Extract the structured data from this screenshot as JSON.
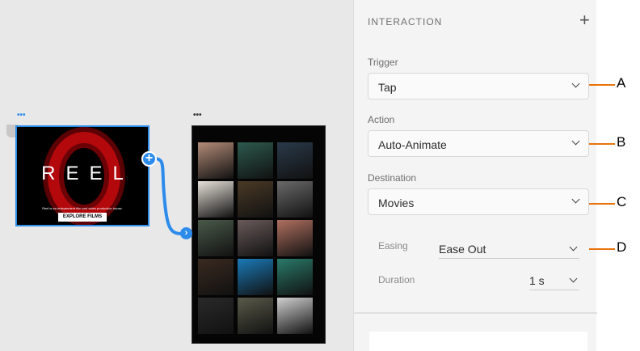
{
  "canvas": {
    "artboard1": {
      "dots": "•••",
      "title": "REEL",
      "tagline": "Reel is an independent film and video production house.",
      "button": "EXPLORE FILMS"
    },
    "artboard2": {
      "dots": "•••",
      "tile_colors": [
        "#b48c78",
        "#2d5a4e",
        "#2a3a4a",
        "#e8e2da",
        "#4a3a26",
        "#6a6a6a",
        "#4a5a4a",
        "#6a5a5a",
        "#b07060",
        "#3a2a20",
        "#1a7ab8",
        "#2a7a6a",
        "#2a2a2a",
        "#5a5a4a",
        "#d0d0d0"
      ]
    },
    "accent": "#2d8ceb"
  },
  "panel": {
    "title": "INTERACTION",
    "add_icon": "+",
    "trigger": {
      "label": "Trigger",
      "value": "Tap"
    },
    "action": {
      "label": "Action",
      "value": "Auto-Animate"
    },
    "destination": {
      "label": "Destination",
      "value": "Movies"
    },
    "easing": {
      "label": "Easing",
      "value": "Ease Out"
    },
    "duration": {
      "label": "Duration",
      "value": "1 s"
    }
  },
  "callouts": [
    "A",
    "B",
    "C",
    "D"
  ],
  "callout_color": "#e8730c"
}
